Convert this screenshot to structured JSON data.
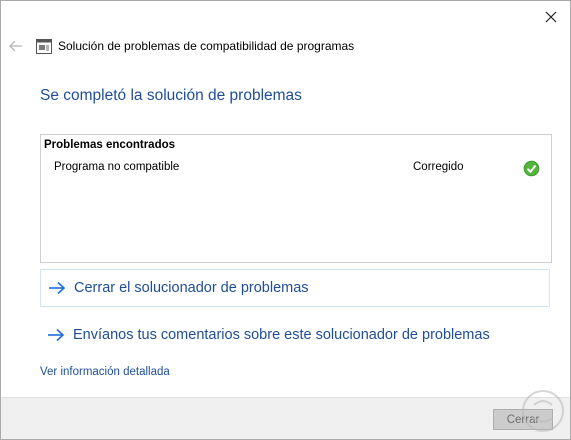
{
  "window": {
    "title": "Solución de problemas de compatibilidad de programas"
  },
  "heading": "Se completó la solución de problemas",
  "problems": {
    "header": "Problemas encontrados",
    "rows": [
      {
        "name": "Programa no compatible",
        "status": "Corregido",
        "status_icon": "check-icon",
        "status_color": "#3a9b28"
      }
    ]
  },
  "actions": [
    {
      "label": "Cerrar el solucionador de problemas",
      "icon": "arrow-right-icon"
    },
    {
      "label": "Envíanos tus comentarios sobre este solucionador de problemas",
      "icon": "arrow-right-icon"
    }
  ],
  "details_link": "Ver información detallada",
  "footer": {
    "close_label": "Cerrar"
  },
  "colors": {
    "accent": "#1f4e99",
    "link_arrow": "#1e6fd9",
    "success": "#3a9b28"
  }
}
